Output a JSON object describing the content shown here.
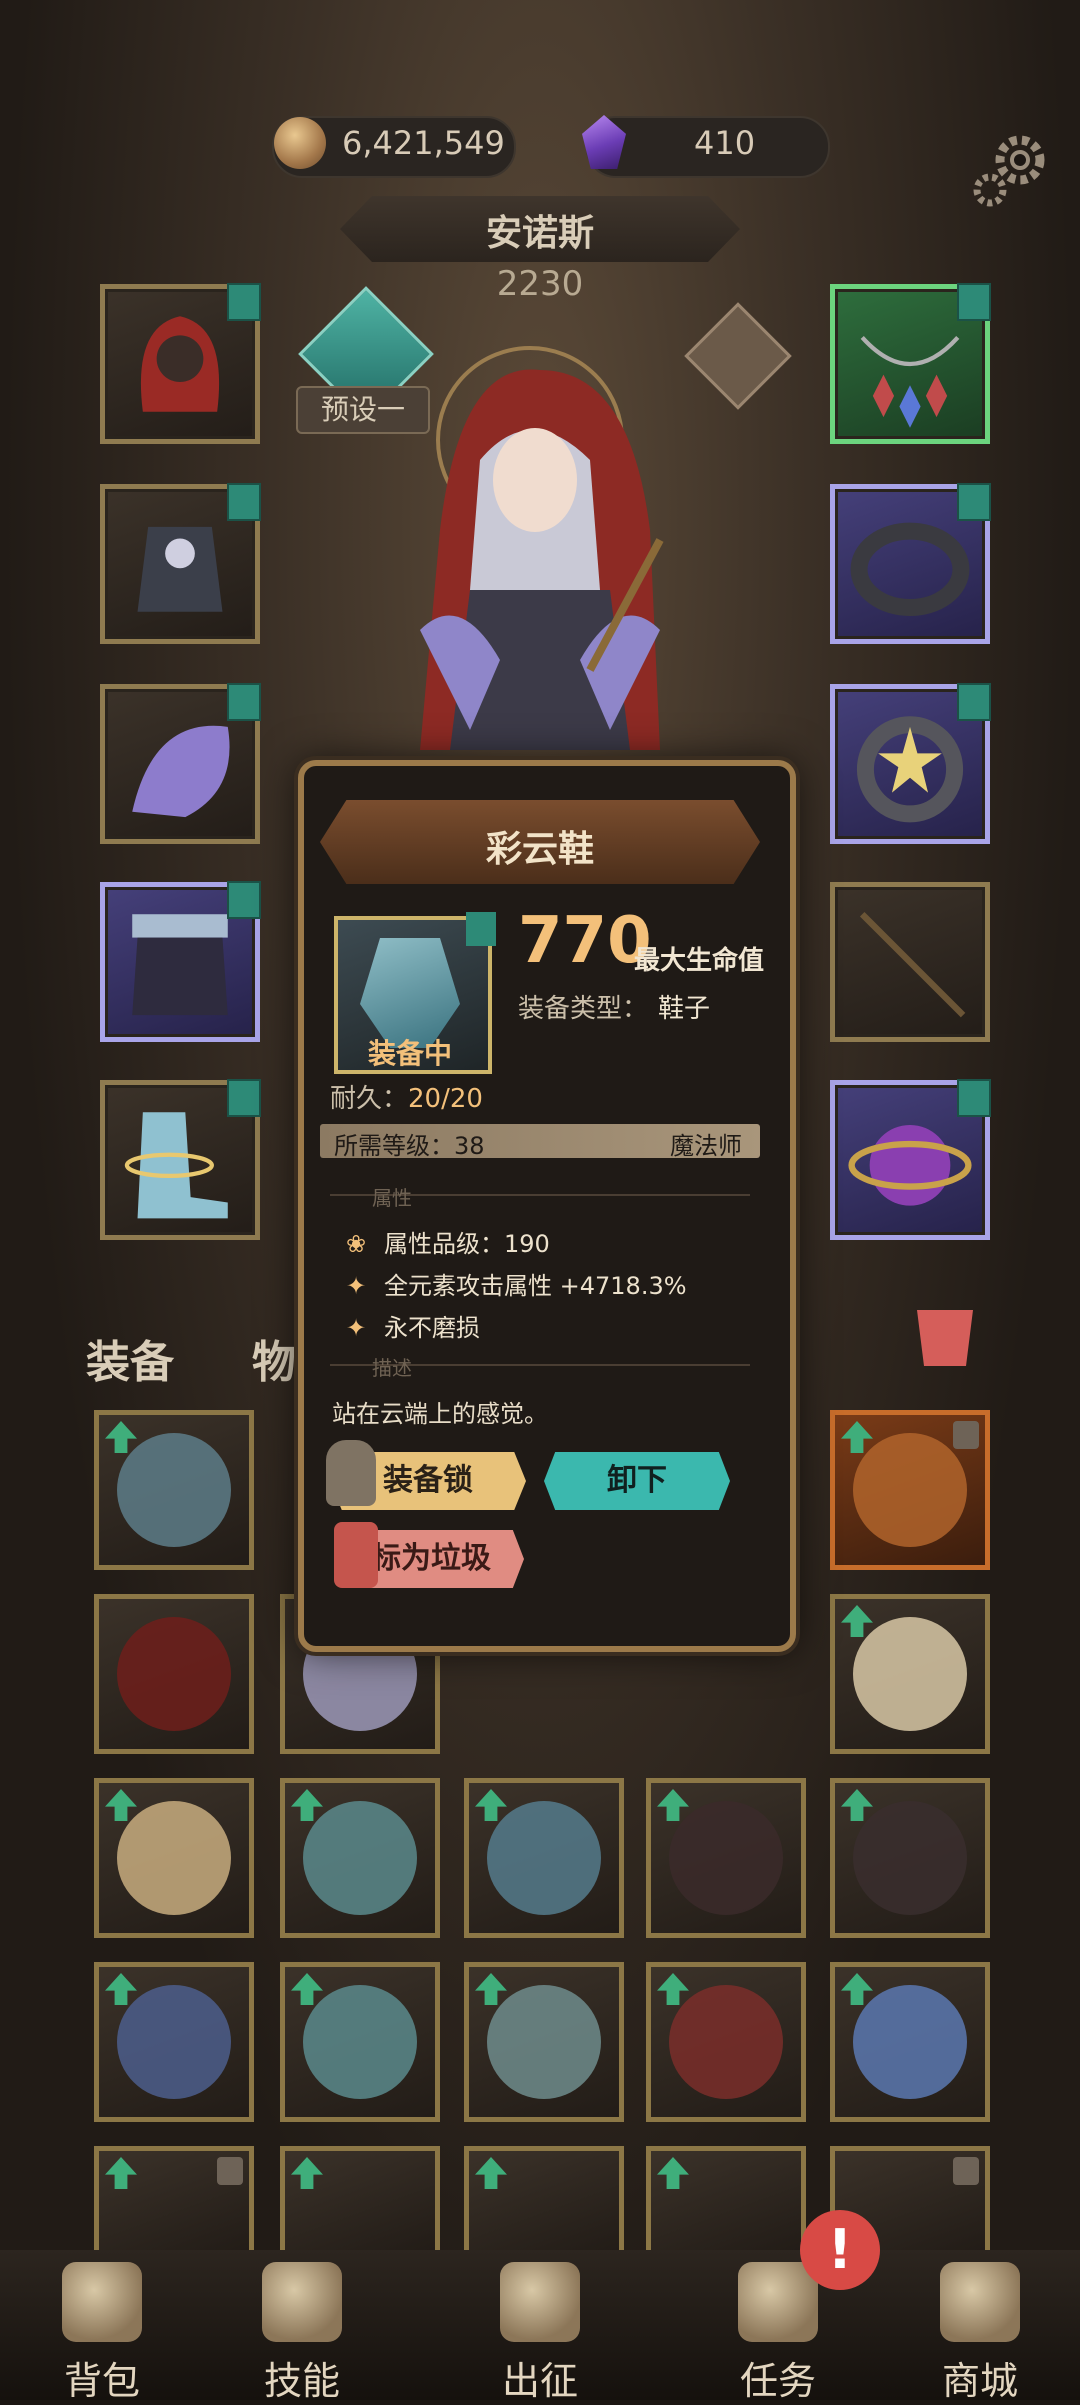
{
  "currency": {
    "gold": "6,421,549",
    "gems": "410"
  },
  "hero": {
    "name": "安诺斯",
    "power": "2230",
    "preset_label": "预设一"
  },
  "tabs": {
    "equipment": "装备",
    "items": "物品"
  },
  "popup": {
    "item_name": "彩云鞋",
    "status": "装备中",
    "stat_value": "770",
    "stat_name": "最大生命值",
    "type_label": "装备类型：",
    "type_value": "鞋子",
    "durability_label": "耐久：",
    "durability_value": "20/20",
    "required_level_label": "所需等级：38",
    "class": "魔法师",
    "attr_section": "属性",
    "attributes": [
      "属性品级：190",
      "全元素攻击属性 +4718.3%",
      "永不磨损"
    ],
    "desc_section": "描述",
    "description": "站在云端上的感觉。",
    "buttons": {
      "lock": "装备锁",
      "unequip": "卸下",
      "trash": "标为垃圾"
    }
  },
  "nav": {
    "items": [
      {
        "label": "背包",
        "icon": "bag-icon"
      },
      {
        "label": "技能",
        "icon": "skill-book-icon"
      },
      {
        "label": "出征",
        "icon": "battle-icon"
      },
      {
        "label": "任务",
        "icon": "quest-scroll-icon"
      },
      {
        "label": "商城",
        "icon": "shop-icon"
      }
    ],
    "alert": "!"
  },
  "colors": {
    "accent_gold": "#f3c07a",
    "teal_button": "#3bb8ae",
    "trash_red": "#d55e5a"
  }
}
